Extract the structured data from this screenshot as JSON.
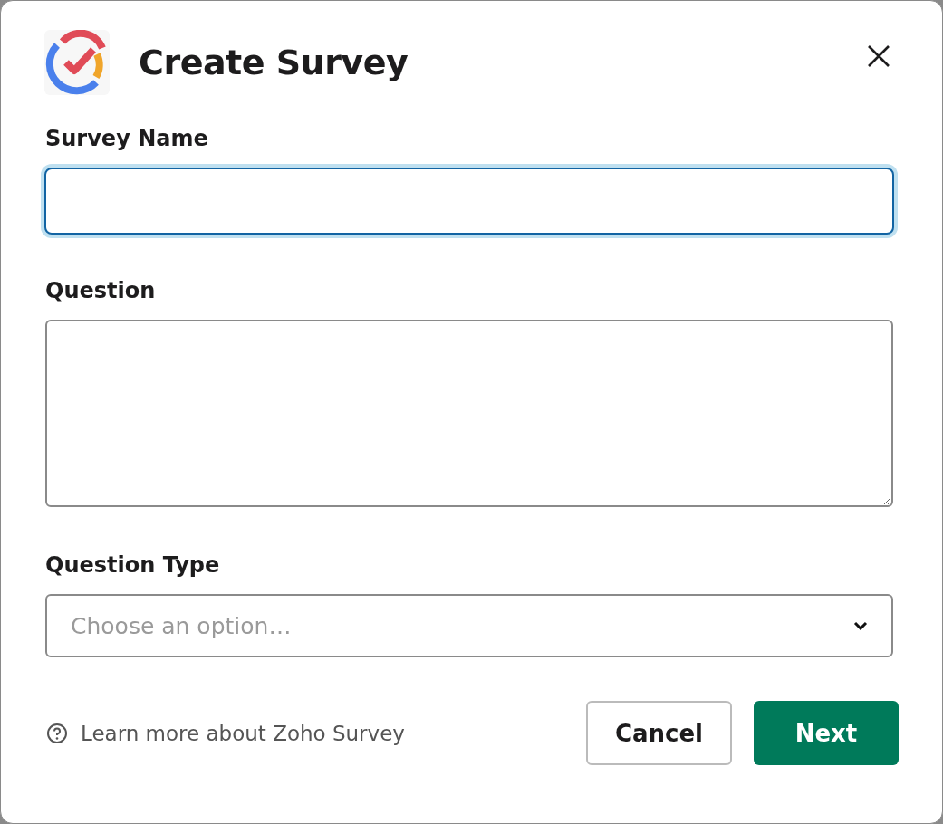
{
  "dialog": {
    "title": "Create Survey"
  },
  "fields": [
    {
      "kind": "input",
      "label": "Survey Name",
      "focused": true
    },
    {
      "kind": "textarea",
      "label": "Question",
      "focused": false
    },
    {
      "kind": "select",
      "label": "Question Type",
      "placeholder": "Choose an option…",
      "focused": false
    }
  ],
  "help_link": "Learn more about Zoho Survey",
  "buttons": [
    {
      "kind": "secondary",
      "label": "Cancel"
    },
    {
      "kind": "primary",
      "label": "Next"
    }
  ]
}
